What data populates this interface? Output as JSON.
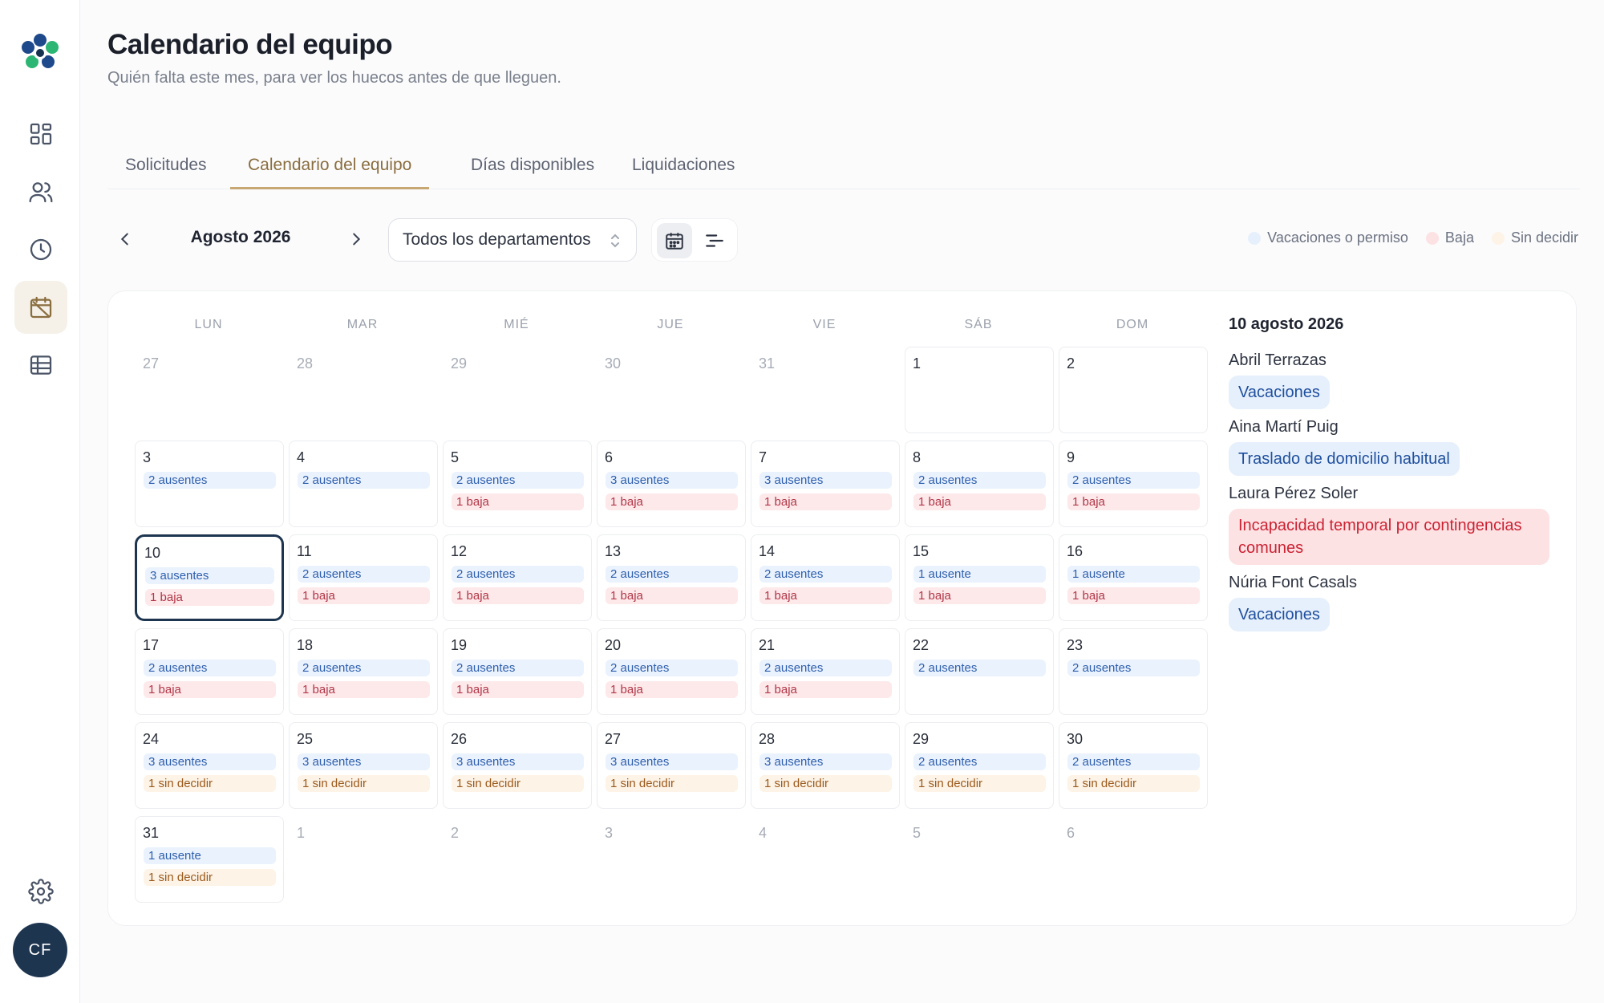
{
  "sidebar": {
    "avatar_initials": "CF"
  },
  "header": {
    "title": "Calendario del equipo",
    "subtitle": "Quién falta este mes, para ver los huecos antes de que lleguen."
  },
  "tabs": [
    {
      "label": "Solicitudes"
    },
    {
      "label": "Calendario del equipo"
    },
    {
      "label": "Días disponibles"
    },
    {
      "label": "Liquidaciones"
    }
  ],
  "toolbar": {
    "month": "Agosto 2026",
    "department": "Todos los departamentos"
  },
  "legend": {
    "leave": "Vacaciones o permiso",
    "sick": "Baja",
    "undecided": "Sin decidir"
  },
  "colors": {
    "leave": "#e6f0fc",
    "sick": "#fde2e4",
    "undecided": "#fdf3e6",
    "accent": "#8a6e3f",
    "selected": "#1e3550"
  },
  "weekdays": [
    "LUN",
    "MAR",
    "MIÉ",
    "JUE",
    "VIE",
    "SÁB",
    "DOM"
  ],
  "calendar": [
    {
      "n": "27",
      "out": true
    },
    {
      "n": "28",
      "out": true
    },
    {
      "n": "29",
      "out": true
    },
    {
      "n": "30",
      "out": true
    },
    {
      "n": "31",
      "out": true
    },
    {
      "n": "1",
      "pills": []
    },
    {
      "n": "2",
      "pills": []
    },
    {
      "n": "3",
      "pills": [
        [
          "absent",
          "2 ausentes"
        ]
      ]
    },
    {
      "n": "4",
      "pills": [
        [
          "absent",
          "2 ausentes"
        ]
      ]
    },
    {
      "n": "5",
      "pills": [
        [
          "absent",
          "2 ausentes"
        ],
        [
          "sick",
          "1 baja"
        ]
      ]
    },
    {
      "n": "6",
      "pills": [
        [
          "absent",
          "3 ausentes"
        ],
        [
          "sick",
          "1 baja"
        ]
      ]
    },
    {
      "n": "7",
      "pills": [
        [
          "absent",
          "3 ausentes"
        ],
        [
          "sick",
          "1 baja"
        ]
      ]
    },
    {
      "n": "8",
      "pills": [
        [
          "absent",
          "2 ausentes"
        ],
        [
          "sick",
          "1 baja"
        ]
      ]
    },
    {
      "n": "9",
      "pills": [
        [
          "absent",
          "2 ausentes"
        ],
        [
          "sick",
          "1 baja"
        ]
      ]
    },
    {
      "n": "10",
      "selected": true,
      "pills": [
        [
          "absent",
          "3 ausentes"
        ],
        [
          "sick",
          "1 baja"
        ]
      ]
    },
    {
      "n": "11",
      "pills": [
        [
          "absent",
          "2 ausentes"
        ],
        [
          "sick",
          "1 baja"
        ]
      ]
    },
    {
      "n": "12",
      "pills": [
        [
          "absent",
          "2 ausentes"
        ],
        [
          "sick",
          "1 baja"
        ]
      ]
    },
    {
      "n": "13",
      "pills": [
        [
          "absent",
          "2 ausentes"
        ],
        [
          "sick",
          "1 baja"
        ]
      ]
    },
    {
      "n": "14",
      "pills": [
        [
          "absent",
          "2 ausentes"
        ],
        [
          "sick",
          "1 baja"
        ]
      ]
    },
    {
      "n": "15",
      "pills": [
        [
          "absent",
          "1 ausente"
        ],
        [
          "sick",
          "1 baja"
        ]
      ]
    },
    {
      "n": "16",
      "pills": [
        [
          "absent",
          "1 ausente"
        ],
        [
          "sick",
          "1 baja"
        ]
      ]
    },
    {
      "n": "17",
      "pills": [
        [
          "absent",
          "2 ausentes"
        ],
        [
          "sick",
          "1 baja"
        ]
      ]
    },
    {
      "n": "18",
      "pills": [
        [
          "absent",
          "2 ausentes"
        ],
        [
          "sick",
          "1 baja"
        ]
      ]
    },
    {
      "n": "19",
      "pills": [
        [
          "absent",
          "2 ausentes"
        ],
        [
          "sick",
          "1 baja"
        ]
      ]
    },
    {
      "n": "20",
      "pills": [
        [
          "absent",
          "2 ausentes"
        ],
        [
          "sick",
          "1 baja"
        ]
      ]
    },
    {
      "n": "21",
      "pills": [
        [
          "absent",
          "2 ausentes"
        ],
        [
          "sick",
          "1 baja"
        ]
      ]
    },
    {
      "n": "22",
      "pills": [
        [
          "absent",
          "2 ausentes"
        ]
      ]
    },
    {
      "n": "23",
      "pills": [
        [
          "absent",
          "2 ausentes"
        ]
      ]
    },
    {
      "n": "24",
      "pills": [
        [
          "absent",
          "3 ausentes"
        ],
        [
          "undecided",
          "1 sin decidir"
        ]
      ]
    },
    {
      "n": "25",
      "pills": [
        [
          "absent",
          "3 ausentes"
        ],
        [
          "undecided",
          "1 sin decidir"
        ]
      ]
    },
    {
      "n": "26",
      "pills": [
        [
          "absent",
          "3 ausentes"
        ],
        [
          "undecided",
          "1 sin decidir"
        ]
      ]
    },
    {
      "n": "27",
      "pills": [
        [
          "absent",
          "3 ausentes"
        ],
        [
          "undecided",
          "1 sin decidir"
        ]
      ]
    },
    {
      "n": "28",
      "pills": [
        [
          "absent",
          "3 ausentes"
        ],
        [
          "undecided",
          "1 sin decidir"
        ]
      ]
    },
    {
      "n": "29",
      "pills": [
        [
          "absent",
          "2 ausentes"
        ],
        [
          "undecided",
          "1 sin decidir"
        ]
      ]
    },
    {
      "n": "30",
      "pills": [
        [
          "absent",
          "2 ausentes"
        ],
        [
          "undecided",
          "1 sin decidir"
        ]
      ]
    },
    {
      "n": "31",
      "pills": [
        [
          "absent",
          "1 ausente"
        ],
        [
          "undecided",
          "1 sin decidir"
        ]
      ]
    },
    {
      "n": "1",
      "out": true
    },
    {
      "n": "2",
      "out": true
    },
    {
      "n": "3",
      "out": true
    },
    {
      "n": "4",
      "out": true
    },
    {
      "n": "5",
      "out": true
    },
    {
      "n": "6",
      "out": true
    }
  ],
  "detail": {
    "date": "10 agosto 2026",
    "people": [
      {
        "name": "Abril Terrazas",
        "type": "leave",
        "label": "Vacaciones"
      },
      {
        "name": "Aina Martí Puig",
        "type": "leave",
        "label": "Traslado de domicilio habitual"
      },
      {
        "name": "Laura Pérez Soler",
        "type": "sick",
        "label": "Incapacidad temporal por contingencias comunes"
      },
      {
        "name": "Núria Font Casals",
        "type": "leave",
        "label": "Vacaciones"
      }
    ]
  }
}
